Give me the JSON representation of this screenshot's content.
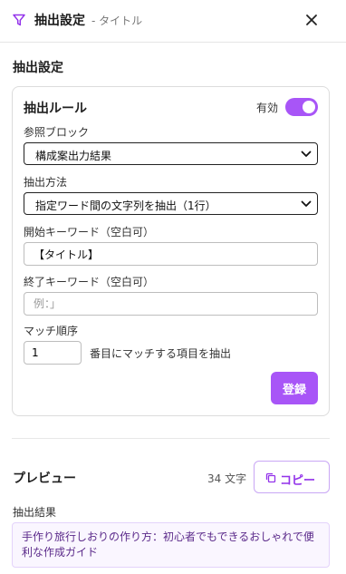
{
  "header": {
    "title": "抽出設定",
    "subtitle": "- タイトル"
  },
  "section": {
    "title": "抽出設定"
  },
  "rule": {
    "title": "抽出ルール",
    "toggle_label": "有効",
    "enabled": true,
    "reference_block_label": "参照ブロック",
    "reference_block_value": "構成案出力結果",
    "method_label": "抽出方法",
    "method_value": "指定ワード間の文字列を抽出（1行）",
    "start_keyword_label": "開始キーワード（空白可）",
    "start_keyword_value": "【タイトル】",
    "end_keyword_label": "終了キーワード（空白可）",
    "end_keyword_placeholder": "例：」",
    "match_order_label": "マッチ順序",
    "match_order_value": "1",
    "match_order_suffix": "番目にマッチする項目を抽出",
    "register_label": "登録"
  },
  "preview": {
    "title": "プレビュー",
    "char_count": "34 文字",
    "copy_label": "コピー",
    "result_label": "抽出結果",
    "result_text": "手作り旅行しおりの作り方：初心者でもできるおしゃれで便利な作成ガイド"
  },
  "colors": {
    "accent": "#a855f7",
    "accent_text": "#9333ea",
    "result_bg": "#faf6ff"
  }
}
